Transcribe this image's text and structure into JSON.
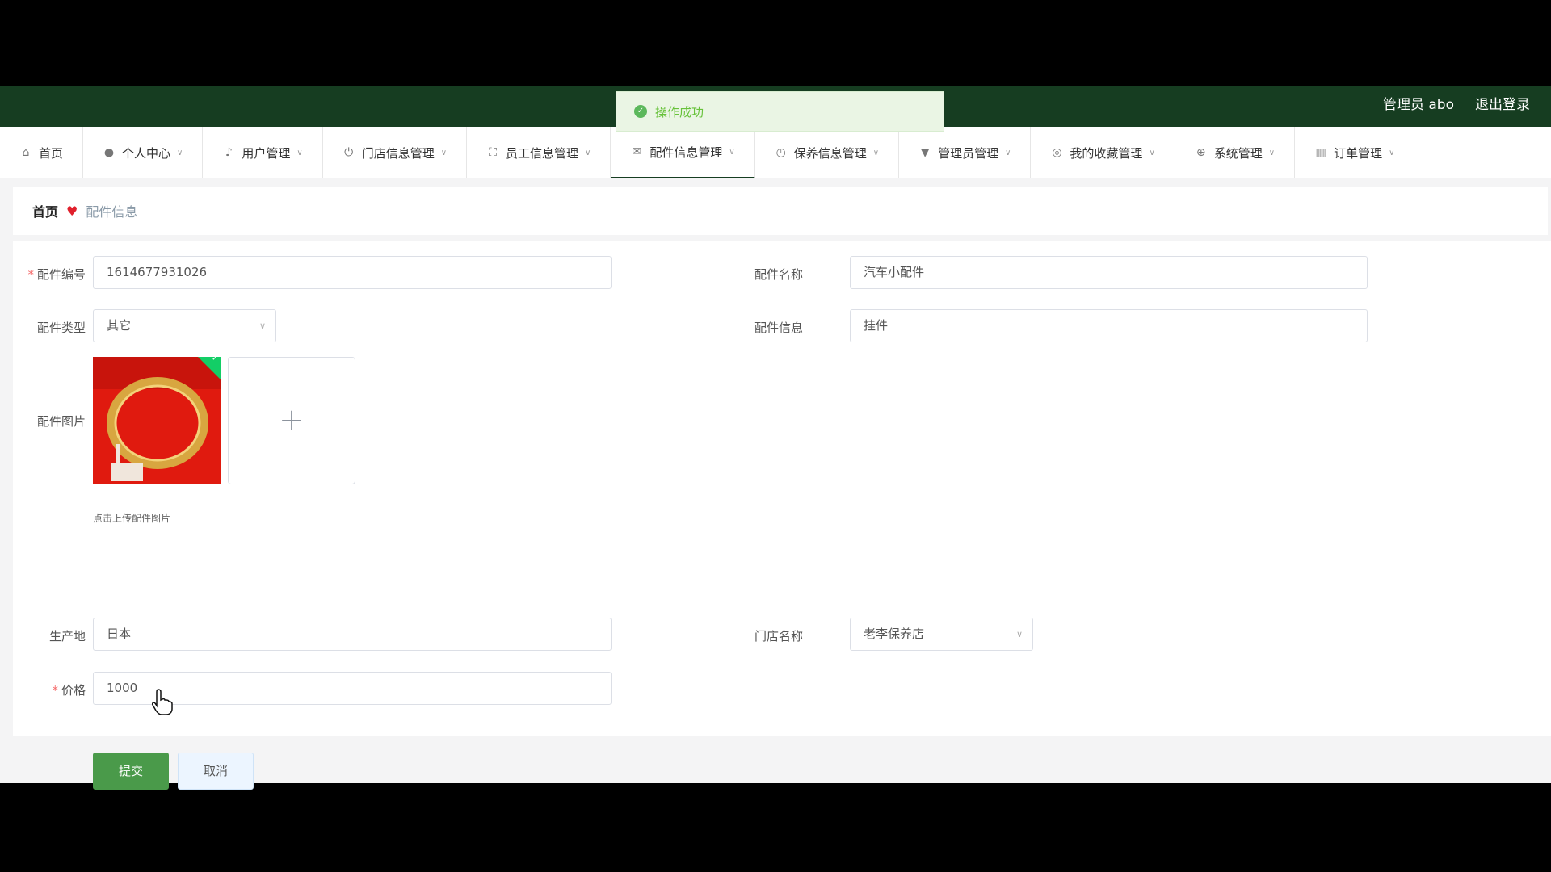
{
  "header": {
    "user_label": "管理员 abo",
    "logout_label": "退出登录"
  },
  "toast": {
    "message": "操作成功"
  },
  "nav": {
    "items": [
      {
        "label": "首页",
        "icon": "home-icon"
      },
      {
        "label": "个人中心",
        "icon": "user-icon"
      },
      {
        "label": "用户管理",
        "icon": "bell-icon"
      },
      {
        "label": "门店信息管理",
        "icon": "power-icon"
      },
      {
        "label": "员工信息管理",
        "icon": "fullscreen-icon"
      },
      {
        "label": "配件信息管理",
        "icon": "mail-icon"
      },
      {
        "label": "保养信息管理",
        "icon": "clock-icon"
      },
      {
        "label": "管理员管理",
        "icon": "flag-icon"
      },
      {
        "label": "我的收藏管理",
        "icon": "globe-icon"
      },
      {
        "label": "系统管理",
        "icon": "compass-icon"
      },
      {
        "label": "订单管理",
        "icon": "chart-icon"
      }
    ]
  },
  "breadcrumb": {
    "home": "首页",
    "current": "配件信息"
  },
  "form": {
    "part_no_label": "配件编号",
    "part_no_value": "1614677931026",
    "part_name_label": "配件名称",
    "part_name_value": "汽车小配件",
    "part_type_label": "配件类型",
    "part_type_value": "其它",
    "part_info_label": "配件信息",
    "part_info_value": "挂件",
    "image_label": "配件图片",
    "upload_hint": "点击上传配件图片",
    "origin_label": "生产地",
    "origin_value": "日本",
    "store_label": "门店名称",
    "store_value": "老李保养店",
    "price_label": "价格",
    "price_value": "1000",
    "submit_label": "提交",
    "cancel_label": "取消"
  },
  "colors": {
    "header_bg": "#163d21",
    "primary_button": "#4a9a4a",
    "success_text": "#67c23a"
  }
}
